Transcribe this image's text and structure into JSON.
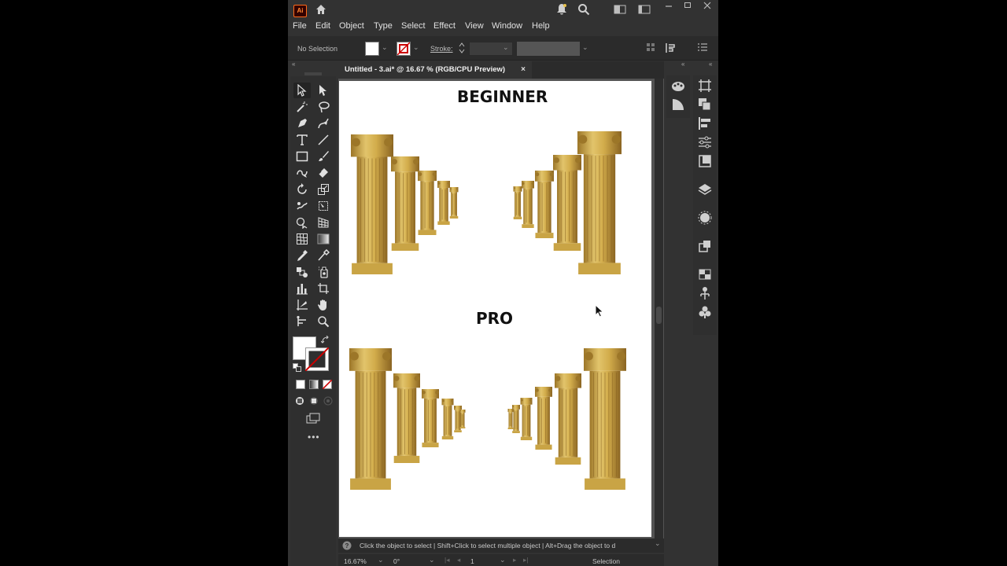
{
  "app": {
    "logo_text": "Ai",
    "icons": [
      "home-icon",
      "bell-icon",
      "search-icon",
      "workspace-icon",
      "arrange-icon",
      "minimize-icon",
      "maximize-icon",
      "close-icon"
    ]
  },
  "menu": {
    "items": [
      "File",
      "Edit",
      "Object",
      "Type",
      "Select",
      "Effect",
      "View",
      "Window",
      "Help"
    ]
  },
  "control": {
    "selection_status": "No Selection",
    "stroke_label": "Stroke:",
    "fill_color": "#ffffff",
    "stroke_color": "#cc0000"
  },
  "document": {
    "tab_title": "Untitled - 3.ai* @ 16.67 % (RGB/CPU Preview)",
    "tab_close": "×"
  },
  "artboard": {
    "heading_top": "BEGINNER",
    "heading_bottom": "PRO",
    "column_color": "#c9a445"
  },
  "status": {
    "hint": "Click the object to select  |  Shift+Click to select multiple object  |  Alt+Drag the object to d",
    "zoom": "16.67%",
    "rotation": "0°",
    "artboard_number": "1",
    "tool_name": "Selection"
  },
  "toolbar": {
    "tools": [
      "selection-tool-icon",
      "direct-selection-tool-icon",
      "magic-wand-icon",
      "lasso-icon",
      "pen-icon",
      "curvature-icon",
      "type-icon",
      "line-icon",
      "rectangle-icon",
      "paintbrush-icon",
      "shaper-icon",
      "eraser-icon",
      "rotate-icon",
      "scale-icon",
      "warp-icon",
      "free-transform-icon",
      "shape-builder-icon",
      "perspective-grid-icon",
      "mesh-icon",
      "gradient-icon",
      "eyedropper-icon",
      "measure-icon",
      "blend-icon",
      "symbol-sprayer-icon",
      "column-graph-icon",
      "artboard-icon",
      "slice-icon",
      "hand-icon",
      "puppet-warp-icon",
      "zoom-icon"
    ]
  }
}
